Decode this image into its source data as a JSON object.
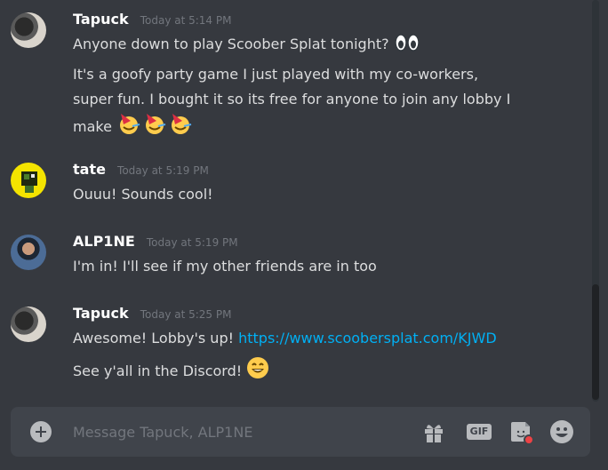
{
  "messages": [
    {
      "author": "Tapuck",
      "timestamp": "Today at 5:14 PM",
      "lines": [
        {
          "text": "Anyone down to play Scoober Splat tonight?"
        },
        {
          "text": "It's a goofy party game I just played with my co-workers,"
        },
        {
          "text": "super fun. I bought it so its free for anyone to join any lobby I"
        },
        {
          "text": "make"
        }
      ]
    },
    {
      "author": "tate",
      "timestamp": "Today at 5:19 PM",
      "lines": [
        {
          "text": "Ouuu! Sounds cool!"
        }
      ]
    },
    {
      "author": "ALP1NE",
      "timestamp": "Today at 5:19 PM",
      "lines": [
        {
          "text": "I'm in! I'll see if my other friends are in too"
        }
      ]
    },
    {
      "author": "Tapuck",
      "timestamp": "Today at 5:25 PM",
      "lines": [
        {
          "text": "Awesome! Lobby's up!",
          "link": "https://www.scoobersplat.com/KJWD"
        },
        {
          "text": "See y'all in the Discord!"
        }
      ]
    }
  ],
  "composer": {
    "placeholder": "Message Tapuck, ALP1NE",
    "value": "",
    "gif_label": "GIF"
  },
  "icons": {
    "upload": "plus-circle-icon",
    "gift": "gift-icon",
    "gif": "gif-icon",
    "sticker": "sticker-icon",
    "emoji": "smile-icon"
  },
  "colors": {
    "background": "#36393f",
    "composer": "#40444b",
    "username": "#ffffff",
    "timestamp": "#72767d",
    "link": "#00b0f4",
    "text": "#dcddde",
    "notification_dot": "#ed4245"
  }
}
